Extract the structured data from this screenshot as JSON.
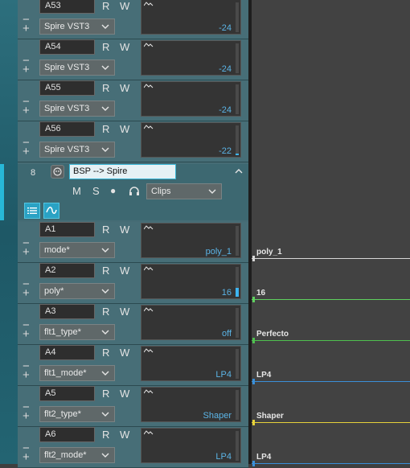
{
  "track_lanes": [
    {
      "id": "A53",
      "device": "Spire VST3",
      "value": "-24"
    },
    {
      "id": "A54",
      "device": "Spire VST3",
      "value": "-24"
    },
    {
      "id": "A55",
      "device": "Spire VST3",
      "value": "-24"
    },
    {
      "id": "A56",
      "device": "Spire VST3",
      "value": "-22"
    }
  ],
  "record_label": "R",
  "write_label": "W",
  "minus_label": "−",
  "plus_label": "+",
  "group": {
    "number": "8",
    "name": "BSP --> Spire",
    "mute_label": "M",
    "solo_label": "S",
    "record_dot": "●",
    "view_dropdown": "Clips"
  },
  "param_lanes": [
    {
      "id": "A1",
      "param": "mode*",
      "value": "poly_1",
      "timeline_label": "poly_1",
      "line_color": "#d8d8d8"
    },
    {
      "id": "A2",
      "param": "poly*",
      "value": "16",
      "timeline_label": "16",
      "line_color": "#5fd05f"
    },
    {
      "id": "A3",
      "param": "flt1_type*",
      "value": "off",
      "timeline_label": "Perfecto",
      "line_color": "#4fc04f"
    },
    {
      "id": "A4",
      "param": "flt1_mode*",
      "value": "LP4",
      "timeline_label": "LP4",
      "line_color": "#3a8fd8"
    },
    {
      "id": "A5",
      "param": "flt2_type*",
      "value": "Shaper",
      "timeline_label": "Shaper",
      "line_color": "#e6d23a"
    },
    {
      "id": "A6",
      "param": "flt2_mode*",
      "value": "LP4",
      "timeline_label": "LP4",
      "line_color": "#3a8fd8"
    }
  ],
  "colors": {
    "accent": "#27b8d8",
    "panel": "#466c75",
    "value_text": "#5bb4e6"
  },
  "icons": {
    "group_icon": "device-icon",
    "headphones": "headphones-icon",
    "list": "list-view-icon",
    "curve": "automation-curve-icon",
    "collapse": "chevron-up-icon",
    "dropdown": "chevron-down-icon",
    "envelope": "waveform-icon"
  }
}
